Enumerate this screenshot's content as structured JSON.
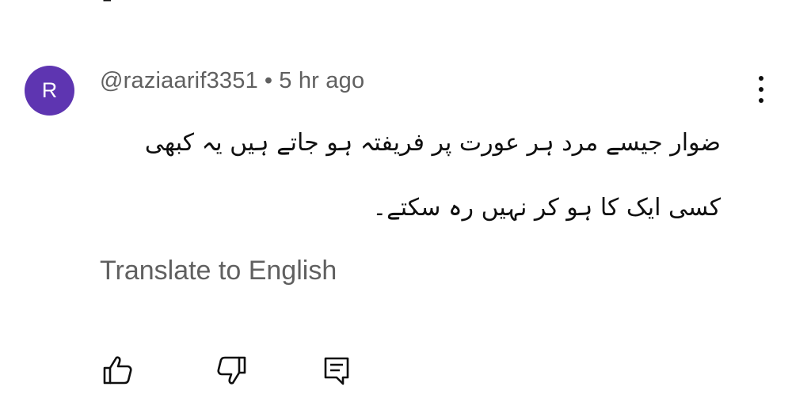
{
  "comment": {
    "avatar_letter": "R",
    "avatar_color": "#5e35b1",
    "author": "@raziaarif3351",
    "separator": "•",
    "timestamp": "5 hr ago",
    "text_lines": [
      "ضوار جیسے مرد ہر عورت پر فریفتہ ہو جاتے ہیں یہ کبھی",
      "کسی ایک کا ہو کر نہیں رہ سکتے۔"
    ],
    "translate_label": "Translate to English",
    "actions": {
      "like_icon": "thumb-up-icon",
      "dislike_icon": "thumb-down-icon",
      "reply_icon": "reply-comment-icon"
    },
    "more_icon": "more-vertical-icon"
  }
}
